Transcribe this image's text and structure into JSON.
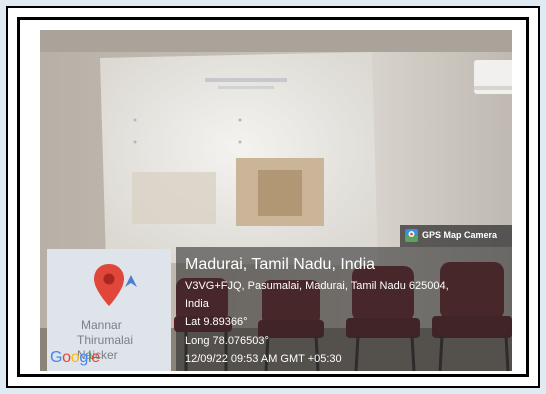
{
  "badge": {
    "label": "GPS Map Camera",
    "icon": "map-pin-icon"
  },
  "location": {
    "title": "Madurai, Tamil Nadu, India",
    "address_line1": "V3VG+FJQ, Pasumalai, Madurai, Tamil Nadu 625004,",
    "address_line2": "India",
    "latitude": "Lat 9.89366°",
    "longitude": "Long 78.076503°",
    "timestamp": "12/09/22 09:53 AM GMT +05:30"
  },
  "map": {
    "label_1": "Mannar",
    "label_2": "Thirumalai",
    "label_3": "Naicker",
    "logo": "Google",
    "pin_icon": "red-location-pin-icon",
    "pin_color": "#e0463a"
  },
  "colors": {
    "frame_background": "#dfeaf3",
    "overlay": "#2d2d2d",
    "chair_color": "#6b1f26"
  }
}
